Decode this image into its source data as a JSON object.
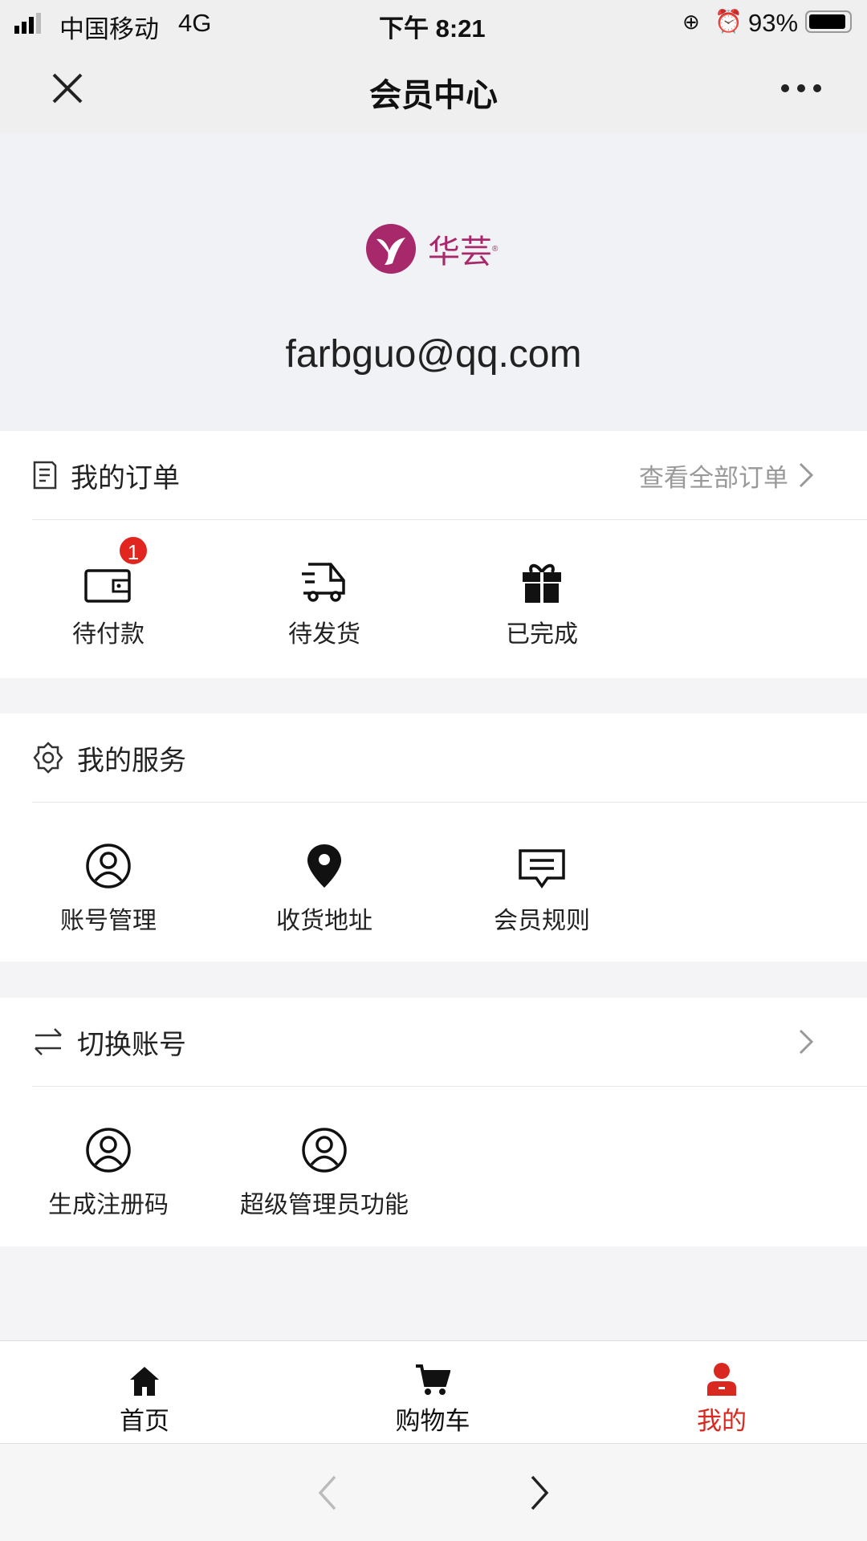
{
  "status": {
    "carrier": "中国移动",
    "network": "4G",
    "time": "下午 8:21",
    "battery": "93%",
    "battery_level": 0.93
  },
  "nav": {
    "title": "会员中心",
    "close_icon": "close-icon",
    "more_icon": "more-icon"
  },
  "header": {
    "logo_text": "华芸",
    "email": "farbguo@qq.com",
    "brand_color": "#a8296b"
  },
  "orders": {
    "title": "我的订单",
    "view_all": "查看全部订单",
    "items": [
      {
        "label": "待付款",
        "icon": "wallet-icon",
        "badge": "1"
      },
      {
        "label": "待发货",
        "icon": "truck-icon"
      },
      {
        "label": "已完成",
        "icon": "gift-icon"
      }
    ]
  },
  "services": {
    "title": "我的服务",
    "items": [
      {
        "label": "账号管理",
        "icon": "user-circle-icon"
      },
      {
        "label": "收货地址",
        "icon": "location-pin-icon"
      },
      {
        "label": "会员规则",
        "icon": "message-icon"
      }
    ]
  },
  "switch": {
    "title": "切换账号",
    "items": [
      {
        "label": "生成注册码",
        "icon": "user-circle-icon"
      },
      {
        "label": "超级管理员功能",
        "icon": "user-circle-icon"
      }
    ]
  },
  "tabbar": {
    "items": [
      {
        "label": "首页",
        "icon": "home-icon"
      },
      {
        "label": "购物车",
        "icon": "cart-icon"
      },
      {
        "label": "我的",
        "icon": "user-icon",
        "active": true
      }
    ],
    "active_color": "#d8281f"
  }
}
